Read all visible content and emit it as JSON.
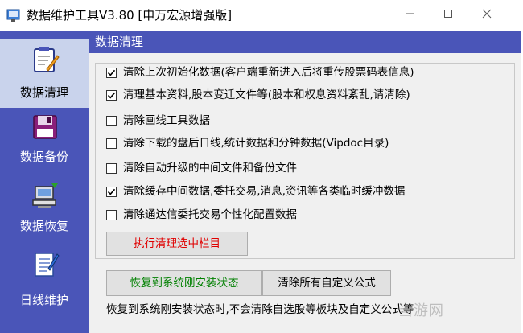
{
  "window": {
    "title": "数据维护工具V3.80 [申万宏源增强版]",
    "controls": [
      "minimize",
      "maximize",
      "close"
    ]
  },
  "sidebar": {
    "items": [
      {
        "label": "数据清理",
        "icon": "clipboard-pencil-icon",
        "active": true
      },
      {
        "label": "数据备份",
        "icon": "floppy-disk-icon",
        "active": false
      },
      {
        "label": "数据恢复",
        "icon": "restore-computer-icon",
        "active": false
      },
      {
        "label": "日线维护",
        "icon": "notepad-icon",
        "active": false
      }
    ]
  },
  "panel": {
    "header": "数据清理",
    "options": [
      {
        "label": "清除上次初始化数据(客户端重新进入后将重传股票码表信息)",
        "checked": true
      },
      {
        "label": "清理基本资料,股本变迁文件等(股本和权息资料紊乱,请清除)",
        "checked": true
      },
      {
        "label": "清除画线工具数据",
        "checked": false
      },
      {
        "label": "清除下载的盘后日线,统计数据和分钟数据(Vipdoc目录)",
        "checked": false
      },
      {
        "label": "清除自动升级的中间文件和备份文件",
        "checked": false
      },
      {
        "label": "清除缓存中间数据,委托交易,消息,资讯等各类临时缓冲数据",
        "checked": true
      },
      {
        "label": "清除通达信委托交易个性化配置数据",
        "checked": false
      }
    ],
    "clean_button": "执行清理选中栏目",
    "restore_button": "恢复到系统刚安装状态",
    "clear_formula_button": "清除所有自定义公式",
    "note": "恢复到系统刚安装状态时,不会清除自选股等板块及自定义公式等"
  },
  "watermark": "当游网",
  "colors": {
    "sidebar": "#4a55b8",
    "sidebar_active": "#c9d3ec",
    "panel_bg": "#f0f0f0",
    "clean_button_text": "#e00000",
    "restore_button_text": "#008000"
  }
}
